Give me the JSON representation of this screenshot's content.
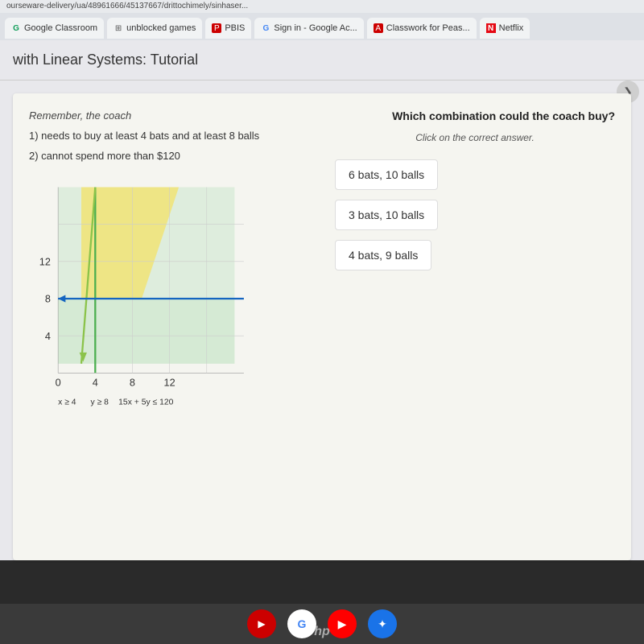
{
  "browser": {
    "url": "ourseware-delivery/ua/48961666/45137667/drittochimely/sinhaser...",
    "tabs": [
      {
        "id": "classroom",
        "label": "Google Classroom",
        "icon": "classroom"
      },
      {
        "id": "games",
        "label": "unblocked games",
        "icon": "grid"
      },
      {
        "id": "pbis",
        "label": "PBIS",
        "icon": "pbis"
      },
      {
        "id": "signin",
        "label": "Sign in - Google Ac...",
        "icon": "google"
      },
      {
        "id": "classwork",
        "label": "Classwork for Peas...",
        "icon": "classwork"
      },
      {
        "id": "netflix",
        "label": "Netflix",
        "icon": "netflix"
      }
    ]
  },
  "page": {
    "title": "with Linear Systems: Tutorial",
    "back_button": "❯"
  },
  "tutorial": {
    "question": "Which combination could the coach buy?",
    "click_instruction": "Click on the correct answer.",
    "remember_heading": "Remember, the coach",
    "conditions": [
      "1) needs to buy at least 4 bats and at least 8 balls",
      "2) cannot spend more than $120"
    ],
    "answers": [
      {
        "id": "a1",
        "text": "6 bats, 10 balls"
      },
      {
        "id": "a2",
        "text": "3 bats, 10 balls"
      },
      {
        "id": "a3",
        "text": "4 bats, 9 balls"
      }
    ],
    "graph": {
      "x_labels": [
        "0",
        "4",
        "8",
        "12"
      ],
      "y_labels": [
        "4",
        "8",
        "12"
      ],
      "inequalities": [
        "x ≥ 4",
        "y ≥ 8",
        "15x + 5y ≤ 120"
      ]
    }
  },
  "taskbar": {
    "icons": [
      {
        "id": "red-app",
        "color": "red",
        "symbol": "▶"
      },
      {
        "id": "google-app",
        "color": "google",
        "symbol": "G"
      },
      {
        "id": "youtube-app",
        "color": "youtube",
        "symbol": "▶"
      },
      {
        "id": "blue-app",
        "color": "blue",
        "symbol": "✦"
      }
    ],
    "hp_label": "hp"
  }
}
